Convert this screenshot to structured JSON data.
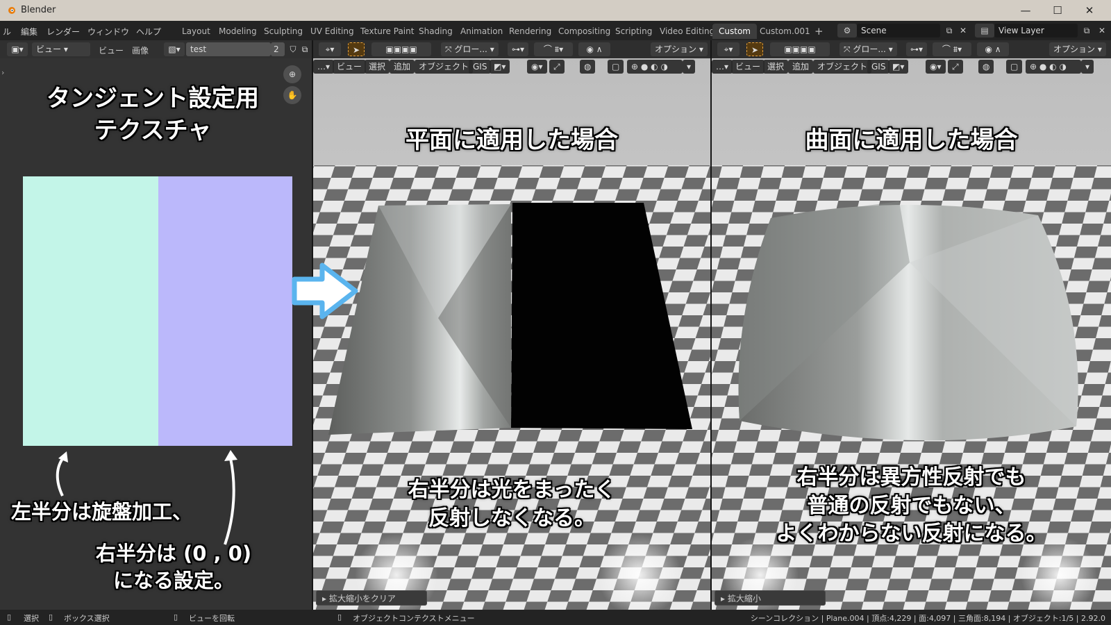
{
  "window": {
    "title": "Blender",
    "minimize": "—",
    "maximize": "☐",
    "close": "✕"
  },
  "menu": {
    "items": [
      "ル",
      "編集",
      "レンダー",
      "ウィンドウ",
      "ヘルプ"
    ]
  },
  "workspaces": [
    "Layout",
    "Modeling",
    "Sculpting",
    "UV Editing",
    "Texture Paint",
    "Shading",
    "Animation",
    "Rendering",
    "Compositing",
    "Scripting",
    "Video Editing",
    "Custom",
    "Custom.001"
  ],
  "active_workspace": "Custom",
  "add_workspace": "+",
  "scene": {
    "name": "Scene",
    "view_layer": "View Layer"
  },
  "image_editor": {
    "view_menu": "ビュー",
    "menu_view": "ビュー",
    "menu_image": "画像",
    "image_name": "test",
    "users": "2",
    "title_line1": "タンジェント設定用",
    "title_line2": "テクスチャ",
    "note_left": "左半分は旋盤加工、",
    "note_right_line1": "右半分は (0 , 0)",
    "note_right_line2": "になる設定。"
  },
  "viewport_left": {
    "transform": "グロー...",
    "options": "オプション",
    "menu": [
      "ビュー",
      "選択",
      "追加",
      "オブジェクト",
      "GIS"
    ],
    "title": "平面に適用した場合",
    "caption_line1": "右半分は光をまったく",
    "caption_line2": "反射しなくなる。",
    "operator": "拡大縮小をクリア"
  },
  "viewport_right": {
    "transform": "グロー...",
    "options": "オプション",
    "menu": [
      "ビュー",
      "選択",
      "追加",
      "オブジェクト",
      "GIS"
    ],
    "title": "曲面に適用した場合",
    "caption_line1": "右半分は異方性反射でも",
    "caption_line2": "普通の反射でもない、",
    "caption_line3": "よくわからない反射になる。",
    "operator": "拡大縮小"
  },
  "statusbar": {
    "select": "選択",
    "box_select": "ボックス選択",
    "rotate_view": "ビューを回転",
    "context_menu": "オブジェクトコンテクストメニュー",
    "stats": "シーンコレクション | Plane.004 | 頂点:4,229 | 面:4,097 | 三角面:8,194 | オブジェクト:1/5 | 2.92.0"
  },
  "colors": {
    "accent": "#e87d0d",
    "arrow": "#5ab4ee",
    "header": "#303030",
    "editor_bg": "#333333"
  }
}
